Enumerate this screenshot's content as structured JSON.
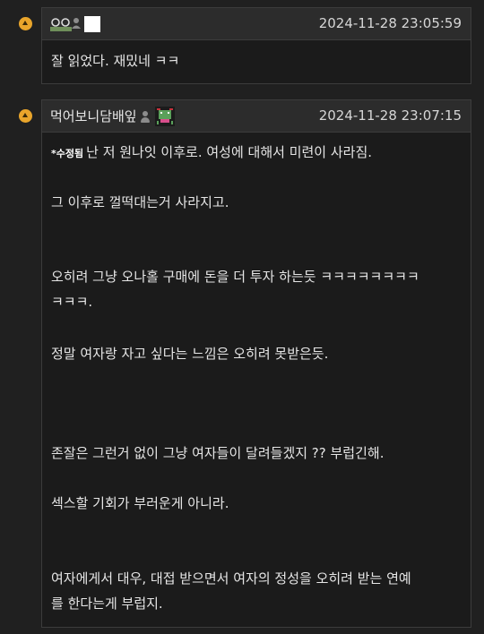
{
  "comments": [
    {
      "nickname": "ㅇㅇ",
      "timestamp": "2024-11-28 23:05:59",
      "lines": [
        "잘 읽었다. 재밌네 ㅋㅋ"
      ]
    },
    {
      "nickname": "먹어보니담배잎",
      "timestamp": "2024-11-28 23:07:15",
      "edited_tag": "*수정됨",
      "lines": [
        "난 저 원나잇 이후로. 여성에 대해서 미련이 사라짐.",
        "그 이후로 껄떡대는거 사라지고.",
        "오히려 그냥 오나홀 구매에 돈을 더 투자 하는듯 ㅋㅋㅋㅋㅋㅋㅋㅋ",
        "ㅋㅋㅋ.",
        "정말 여자랑 자고 싶다는 느낌은 오히려 못받은듯.",
        "존잘은 그런거 없이 그냥 여자들이 달려들겠지 ?? 부럽긴해.",
        "섹스할 기회가 부러운게 아니라.",
        "여자에게서 대우, 대접 받으면서 여자의 정성을 오히려 받는 연예",
        "를 한다는게 부럽지."
      ]
    }
  ],
  "colors": {
    "background": "#202020",
    "panel": "#1b1b1b",
    "header": "#2c2c2c",
    "border": "#3c3c3c",
    "bullet": "#e9a52b"
  },
  "icons": [
    "reply-bullet-icon",
    "user-icon",
    "gallery-nick-icon",
    "fixed-nick-icon"
  ]
}
